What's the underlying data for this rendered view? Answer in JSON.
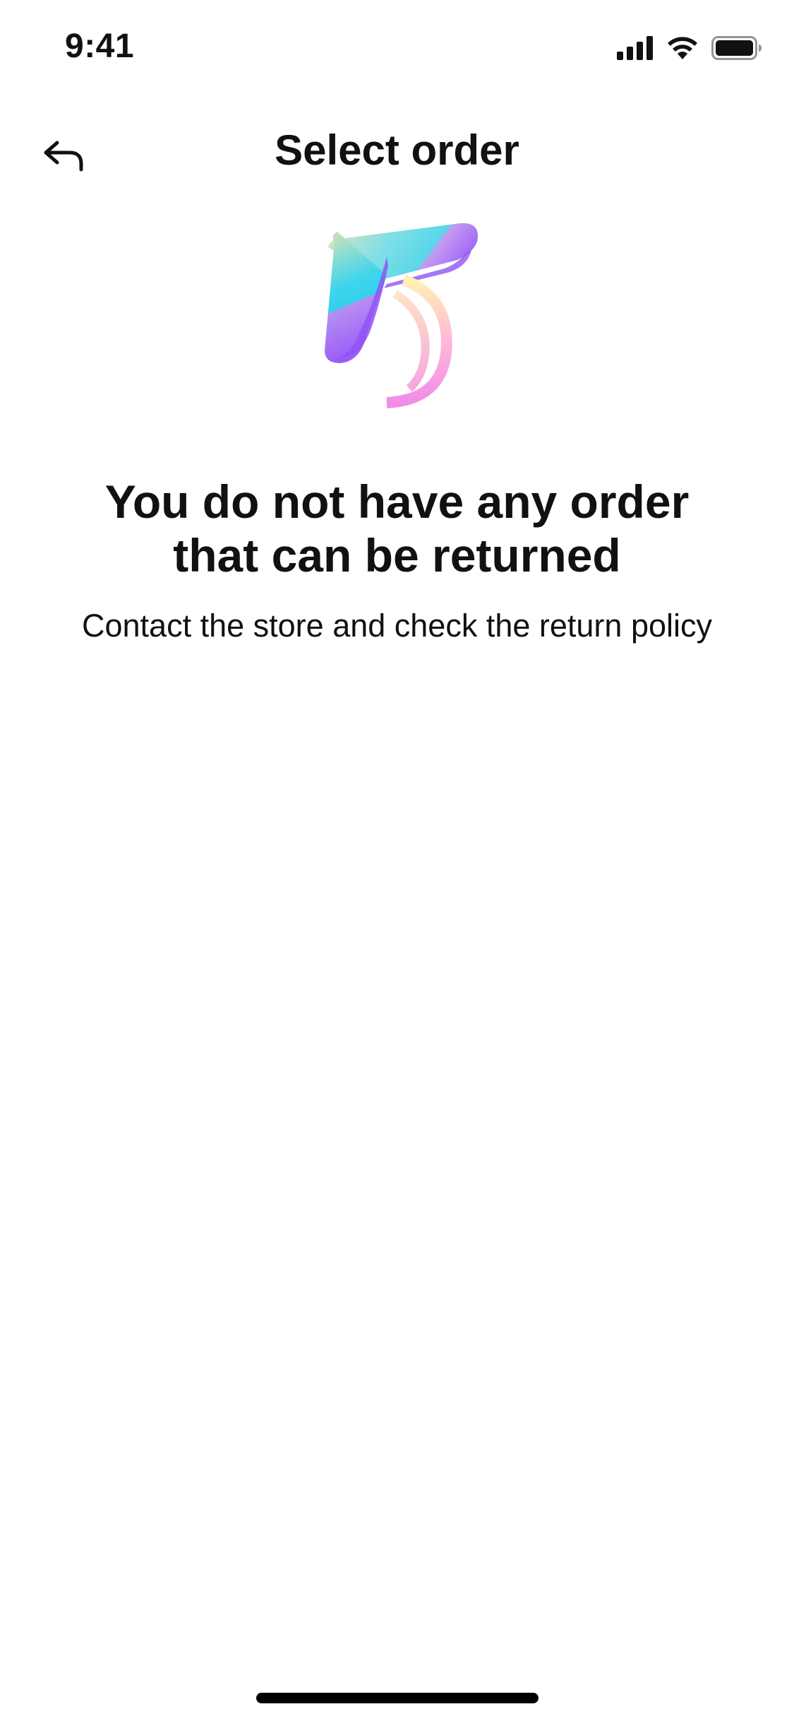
{
  "status_bar": {
    "time": "9:41",
    "icons": [
      "signal-icon",
      "wifi-icon",
      "battery-icon"
    ]
  },
  "nav": {
    "back_icon": "back-arrow-icon",
    "title": "Select order"
  },
  "empty_state": {
    "illustration": "boomerang-return-illustration",
    "title_line1": "You do not have any order",
    "title_line2": "that can be returned",
    "subtitle": "Contact the store and check the return policy"
  },
  "colors": {
    "text": "#111111",
    "background": "#ffffff",
    "illustration_purple": "#9b5cf6",
    "illustration_cyan": "#36d3ea",
    "illustration_pink": "#f08ce8",
    "illustration_yellow": "#fff3b0"
  }
}
